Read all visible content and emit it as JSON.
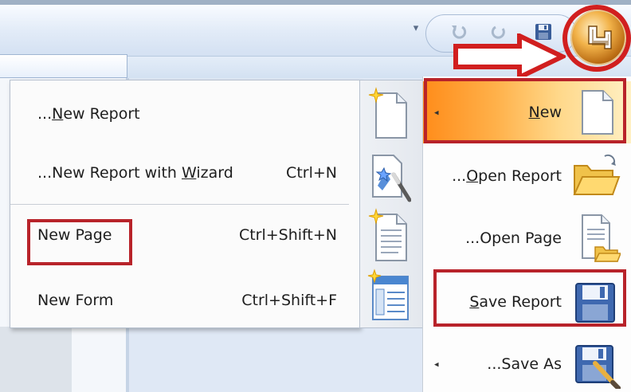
{
  "submenu": {
    "items": [
      {
        "label_pre": "...",
        "label_ul": "N",
        "label_post": "ew Report",
        "shortcut": ""
      },
      {
        "label_pre": "...New Report with ",
        "label_ul": "W",
        "label_post": "izard",
        "shortcut": "Ctrl+N"
      },
      {
        "label_pre": "New Page",
        "label_ul": "",
        "label_post": "",
        "shortcut": "Ctrl+Shift+N"
      },
      {
        "label_pre": "New Form",
        "label_ul": "",
        "label_post": "",
        "shortcut": "Ctrl+Shift+F"
      }
    ]
  },
  "mainmenu": {
    "items": [
      {
        "label_pre": "",
        "label_ul": "N",
        "label_post": "ew",
        "icon": "new-document-icon"
      },
      {
        "label_pre": "...",
        "label_ul": "O",
        "label_post": "pen Report",
        "icon": "open-folder-icon"
      },
      {
        "label_pre": "...Open Page",
        "label_ul": "",
        "label_post": "",
        "icon": "open-page-icon"
      },
      {
        "label_pre": "",
        "label_ul": "S",
        "label_post": "ave Report",
        "icon": "save-icon"
      },
      {
        "label_pre": "...Save As",
        "label_ul": "",
        "label_post": "",
        "icon": "save-as-icon"
      }
    ]
  },
  "colors": {
    "highlight_border": "#b8232a",
    "new_item_gradient_start": "#ff8c1a",
    "office_button": "#e8a33a"
  }
}
